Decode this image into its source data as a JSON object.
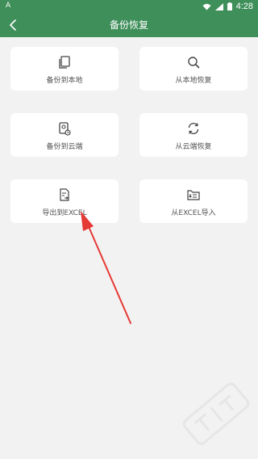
{
  "status_bar": {
    "left_glyph": "A",
    "time": "4:28",
    "icons": [
      "wifi-icon",
      "signal-icon",
      "battery-icon"
    ]
  },
  "app_bar": {
    "title": "备份恢复",
    "back_icon": "chevron-left-icon"
  },
  "cards": [
    {
      "label": "备份到本地",
      "icon": "copy-files-icon"
    },
    {
      "label": "从本地恢复",
      "icon": "search-icon"
    },
    {
      "label": "备份到云端",
      "icon": "cloud-device-icon"
    },
    {
      "label": "从云端恢复",
      "icon": "refresh-icon"
    },
    {
      "label": "导出到EXCEL",
      "icon": "document-export-icon"
    },
    {
      "label": "从EXCEL导入",
      "icon": "excel-import-icon"
    }
  ],
  "colors": {
    "primary": "#3f8f5a",
    "background": "#f2f2f2",
    "card": "#ffffff",
    "arrow": "#e53935"
  }
}
